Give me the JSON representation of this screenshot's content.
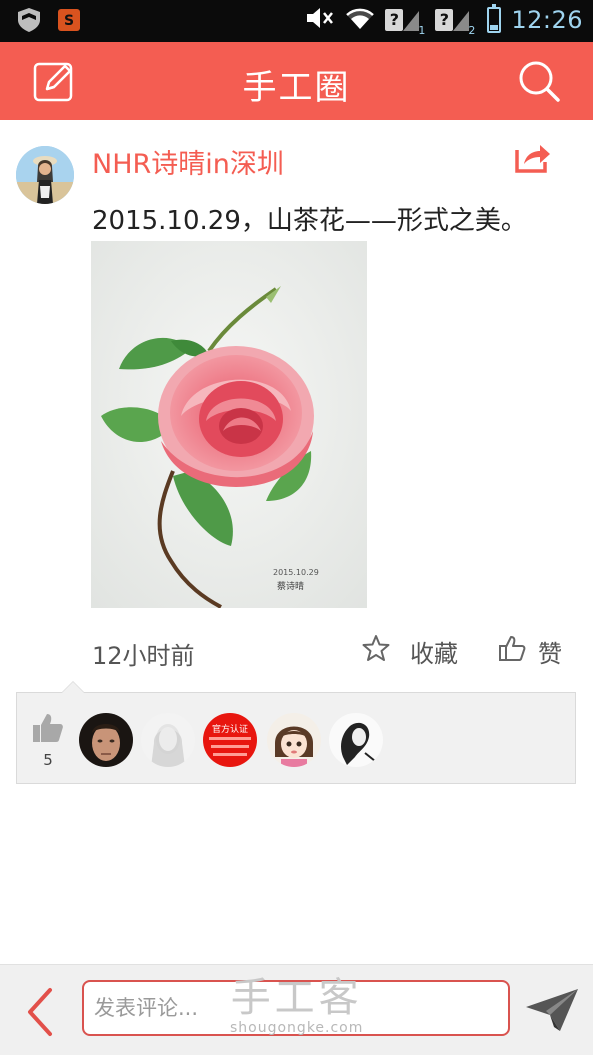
{
  "status_bar": {
    "time": "12:26",
    "sim1_label": "?",
    "sim1_index": "1",
    "sim2_label": "?",
    "sim2_index": "2",
    "notification_icons": [
      "shield-icon",
      "sogou-s-icon"
    ],
    "status_icons": [
      "mute-icon",
      "wifi-icon",
      "signal-icon",
      "battery-icon"
    ],
    "battery_level": 0.25
  },
  "header": {
    "title": "手工圈",
    "left_icon": "edit-icon",
    "right_icon": "search-icon",
    "color": "#f45d52"
  },
  "post": {
    "author": "NHR诗晴in深圳",
    "text": "2015.10.29，山茶花——形式之美。",
    "time": "12小时前",
    "favorite_label": "收藏",
    "like_label": "赞",
    "share_icon": "share-icon",
    "image_signature": "2015.10.29 蔡诗晴"
  },
  "likes": {
    "count": "5",
    "liker_avatar_text": "官方认证"
  },
  "bottom": {
    "comment_placeholder": "发表评论...",
    "watermark_title": "手工客",
    "watermark_url": "shougongke.com"
  },
  "colors": {
    "accent": "#f45d52",
    "input_border": "#d9534f",
    "panel_bg": "#f1f1f1"
  }
}
